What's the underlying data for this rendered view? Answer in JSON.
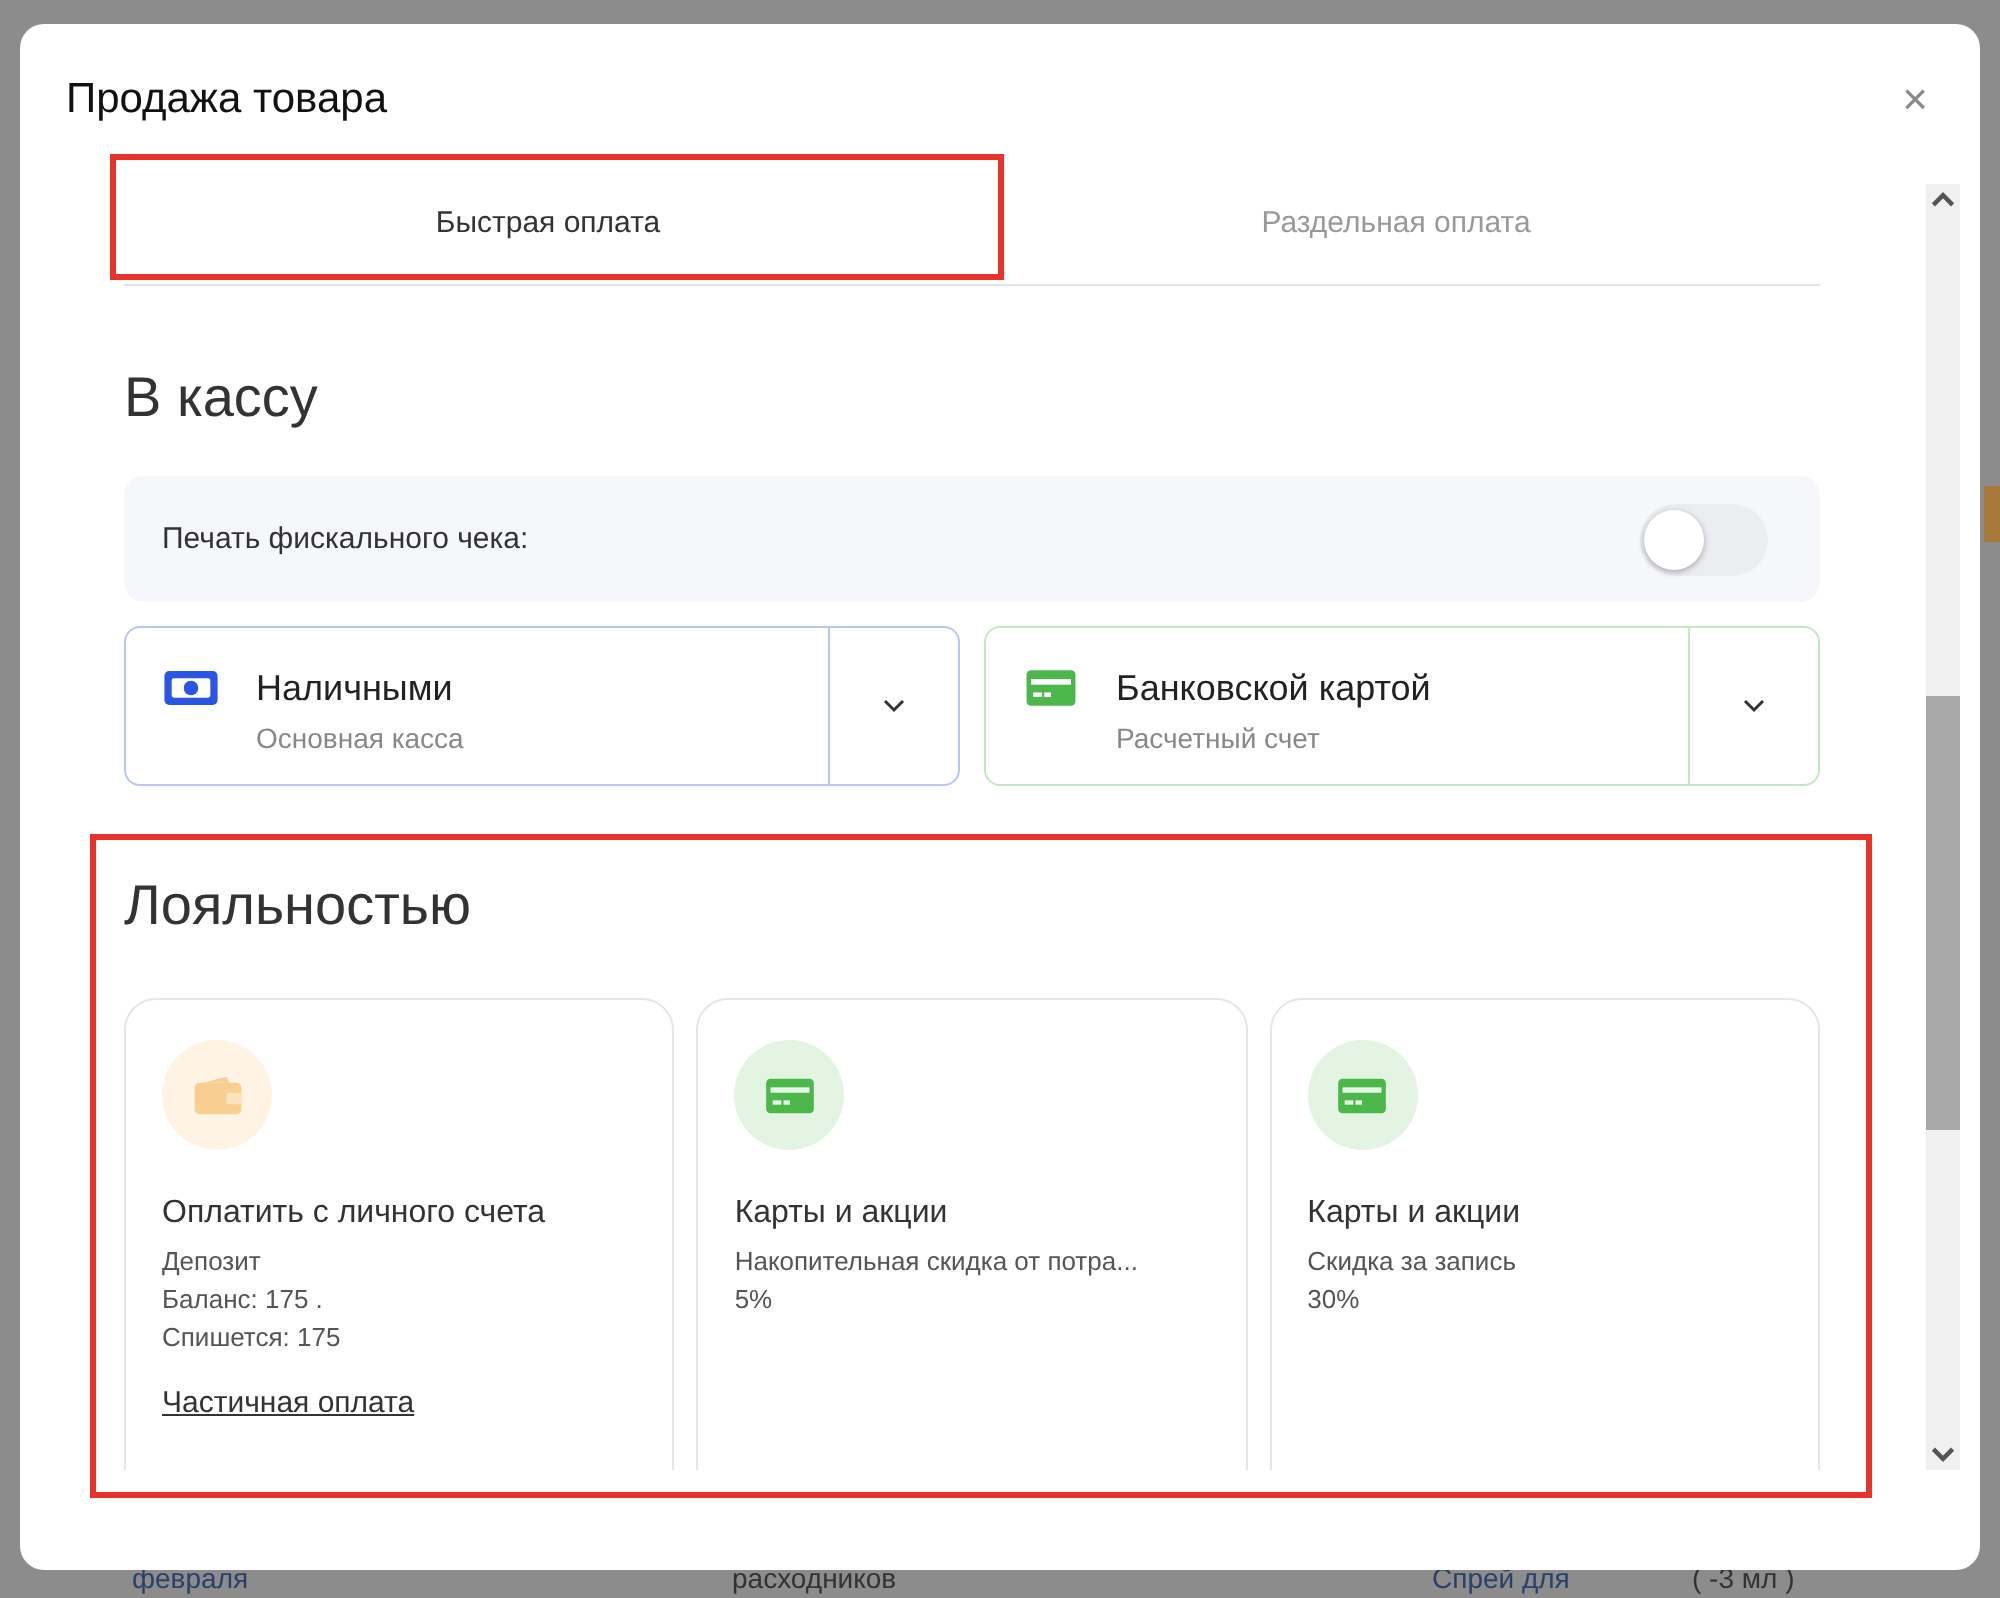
{
  "background": {
    "row": [
      "февраля",
      "расходников",
      "Спрей для",
      "( -3 мл )"
    ]
  },
  "dialog": {
    "title": "Продажа товара",
    "close": "×"
  },
  "tabs": [
    {
      "label": "Быстрая оплата",
      "selected": true
    },
    {
      "label": "Раздельная оплата",
      "selected": false
    }
  ],
  "register": {
    "heading": "В кассу",
    "fiscal": {
      "label": "Печать фискального чека:",
      "on": false
    },
    "methods": [
      {
        "kind": "cash",
        "name": "Наличными",
        "account": "Основная касса",
        "color": "#2a55e5"
      },
      {
        "kind": "card",
        "name": "Банковской картой",
        "account": "Расчетный счет",
        "color": "#4cb84c"
      }
    ]
  },
  "loyalty": {
    "heading": "Лояльностью",
    "cards": [
      {
        "kind": "wallet",
        "title": "Оплатить с личного счета",
        "lines": [
          "Депозит",
          "Баланс: 175 .",
          "Спишется: 175"
        ],
        "link": "Частичная оплата"
      },
      {
        "kind": "card",
        "title": "Карты и акции",
        "lines": [
          "Накопительная скидка от потра...",
          "5%"
        ]
      },
      {
        "kind": "card",
        "title": "Карты и акции",
        "lines": [
          "Скидка за запись",
          "30%"
        ]
      }
    ]
  }
}
